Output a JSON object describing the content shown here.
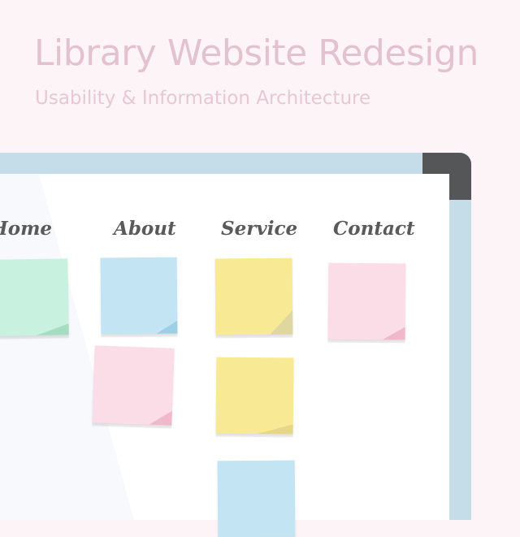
{
  "header": {
    "title": "Library Website Redesign",
    "subtitle": "Usability & Information Architecture"
  },
  "board": {
    "columns": [
      {
        "label": "Home"
      },
      {
        "label": "About"
      },
      {
        "label": "Service"
      },
      {
        "label": "Contact"
      }
    ]
  },
  "colors": {
    "background": "#fdf4f7",
    "board_frame": "#c5dde9",
    "board_corner": "#555657",
    "note_green": "#c9f1df",
    "note_blue": "#c2e4f3",
    "note_yellow": "#f8ea95",
    "note_pink": "#fbdde7"
  }
}
